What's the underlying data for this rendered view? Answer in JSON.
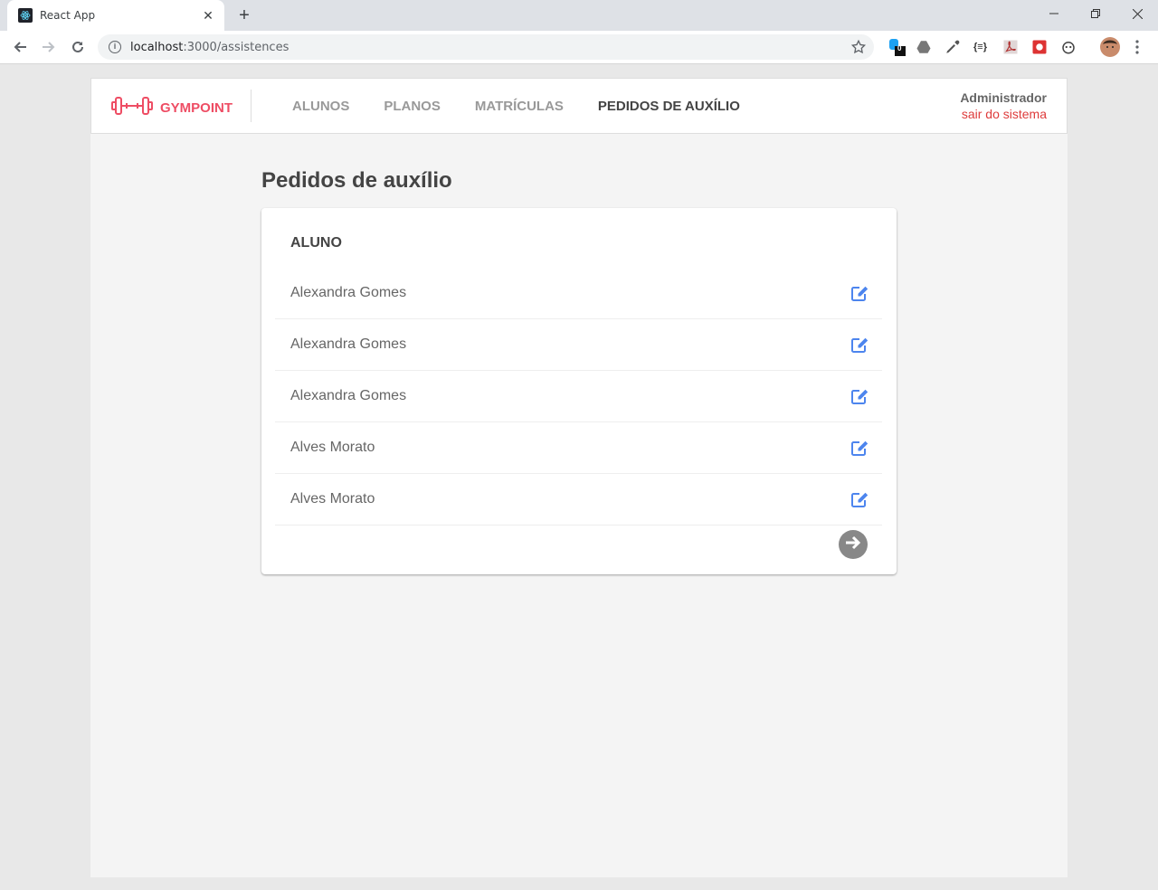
{
  "browser": {
    "tab_title": "React App",
    "url_host": "localhost",
    "url_path": ":3000/assistences",
    "extension_badge": "0"
  },
  "app": {
    "brand": "GYMPOINT",
    "brand_color": "#ee4d64",
    "menu": [
      {
        "label": "ALUNOS",
        "active": false
      },
      {
        "label": "PLANOS",
        "active": false
      },
      {
        "label": "MATRÍCULAS",
        "active": false
      },
      {
        "label": "PEDIDOS DE AUXÍLIO",
        "active": true
      }
    ],
    "user": {
      "name": "Administrador",
      "logout": "sair do sistema"
    }
  },
  "main": {
    "title": "Pedidos de auxílio",
    "table": {
      "column": "ALUNO",
      "rows": [
        {
          "name": "Alexandra Gomes"
        },
        {
          "name": "Alexandra Gomes"
        },
        {
          "name": "Alexandra Gomes"
        },
        {
          "name": "Alves Morato"
        },
        {
          "name": "Alves Morato"
        }
      ]
    },
    "accent_blue": "#4d85ee"
  }
}
